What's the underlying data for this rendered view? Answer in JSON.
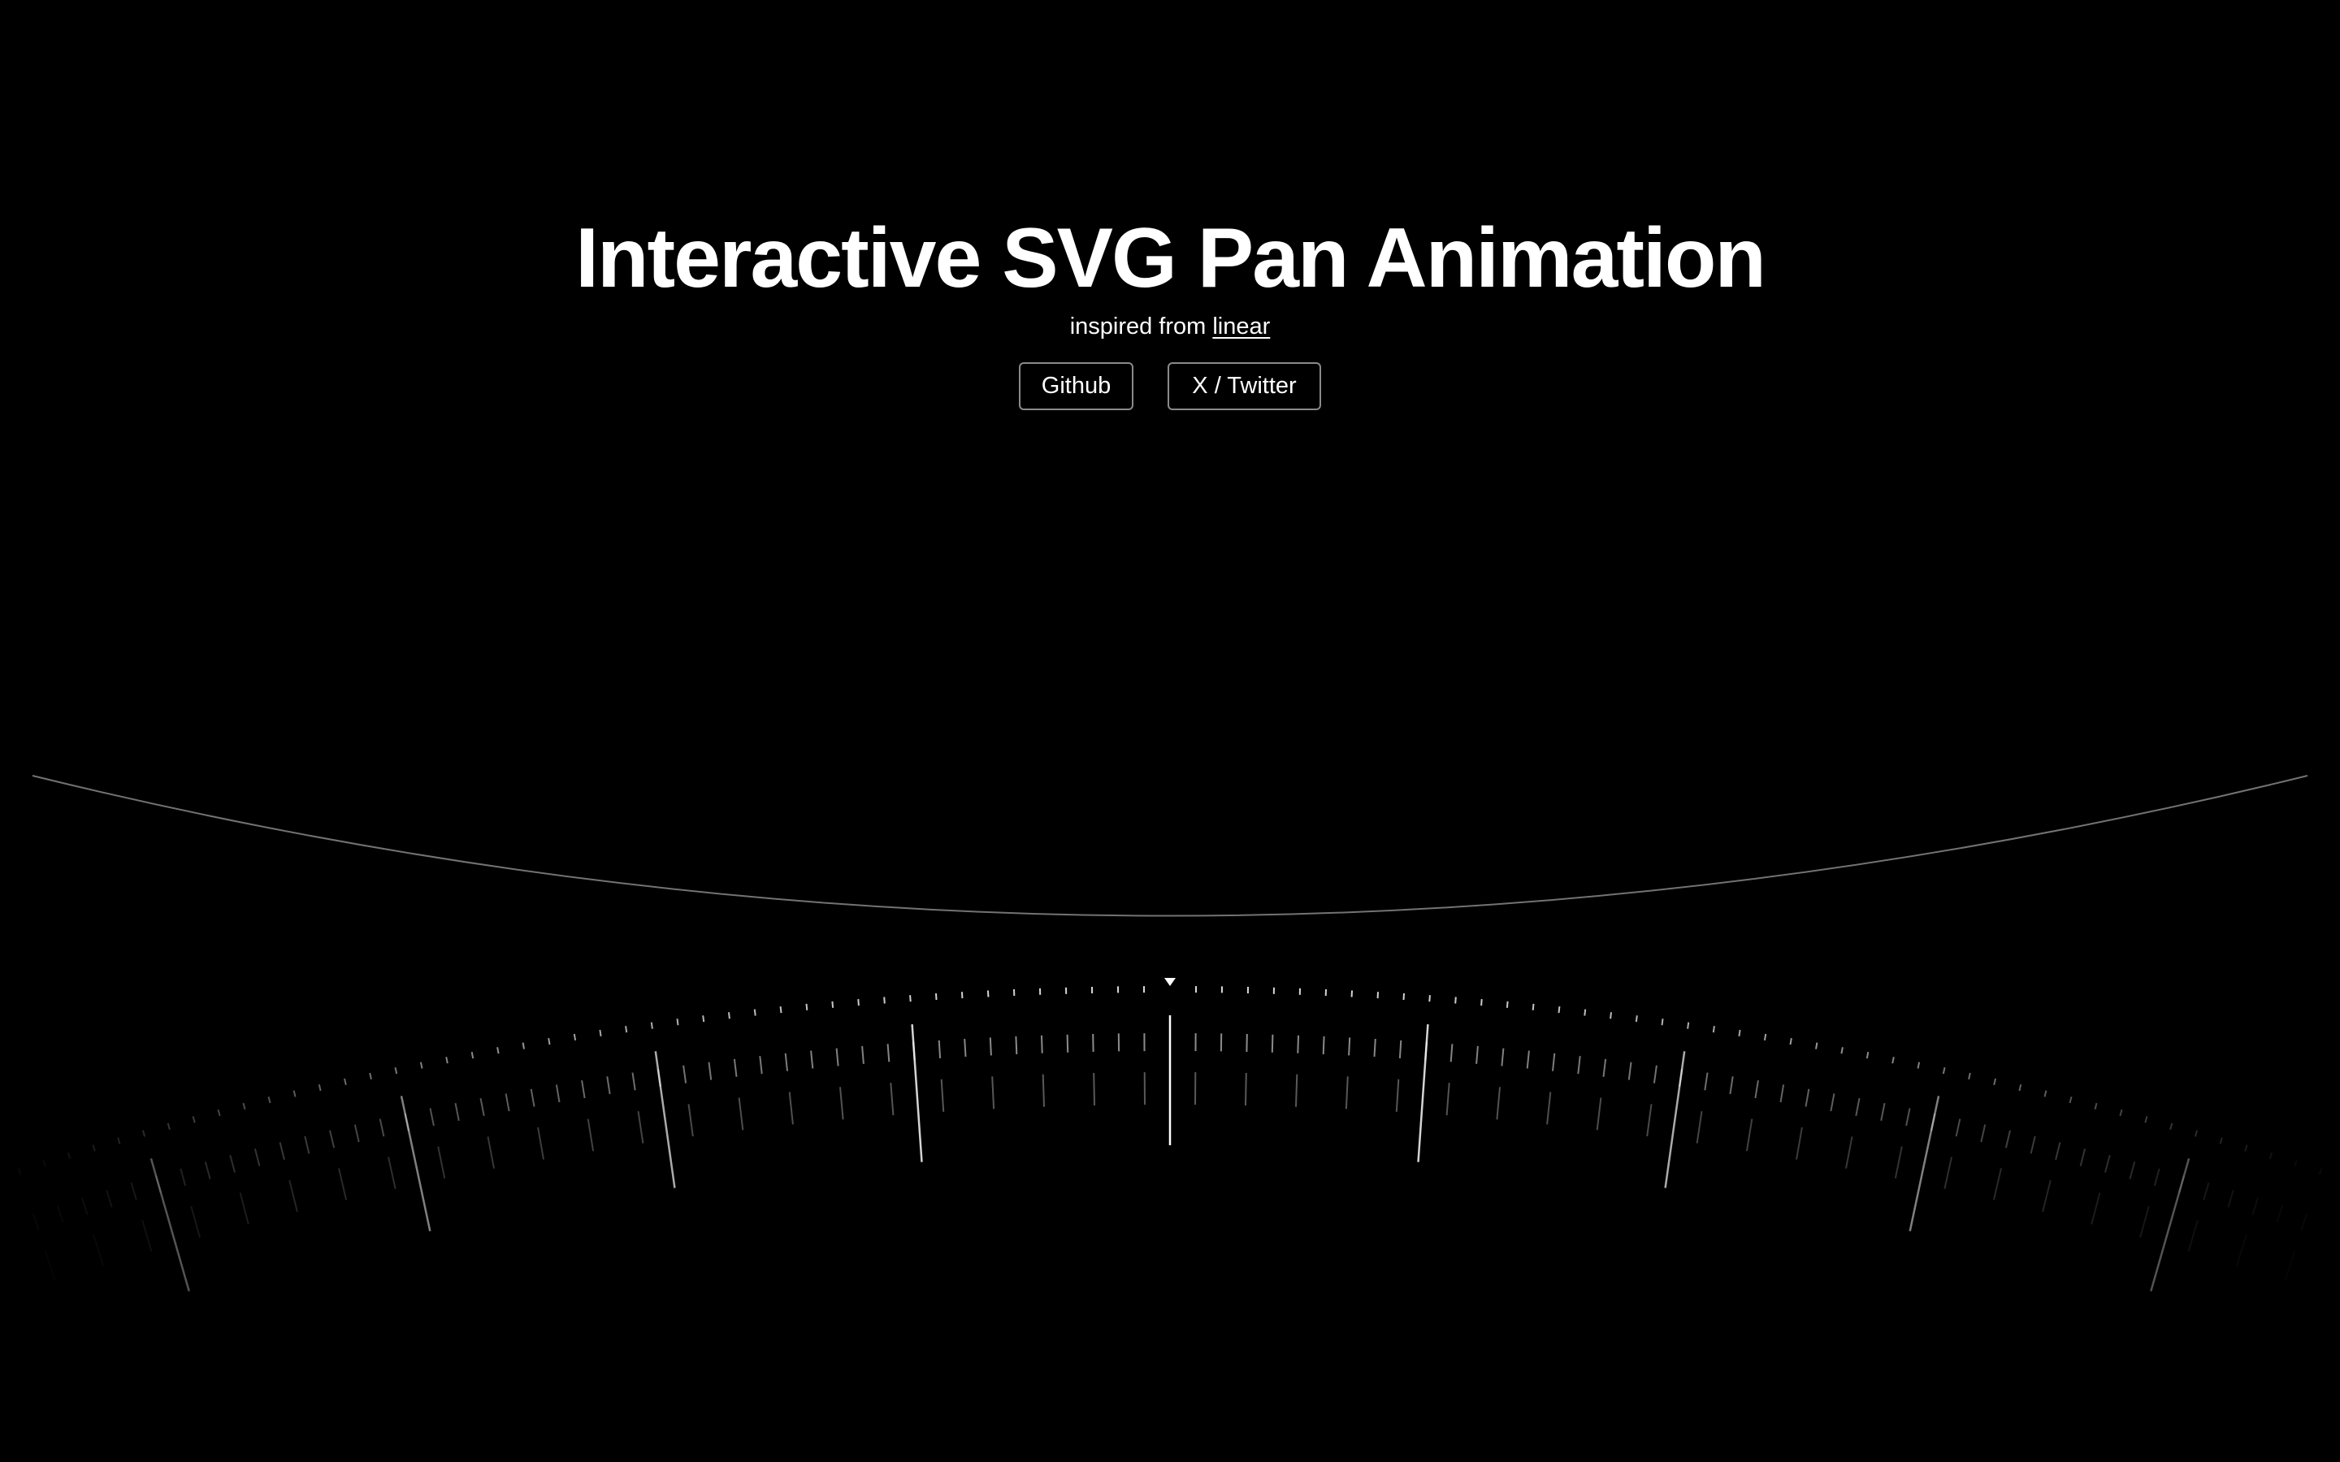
{
  "header": {
    "title": "Interactive SVG Pan Animation",
    "subtitle_prefix": "inspired from ",
    "subtitle_link": "linear"
  },
  "buttons": {
    "github_label": "Github",
    "twitter_label": "X / Twitter"
  },
  "dial": {
    "marker_icon": "triangle-marker-icon",
    "stroke_color": "#ffffff",
    "background_color": "#000000"
  }
}
